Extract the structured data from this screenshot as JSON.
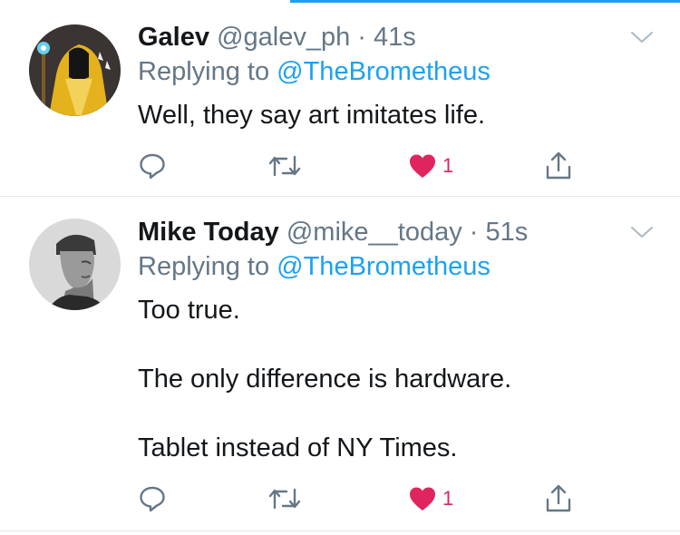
{
  "tweets": [
    {
      "name": "Galev",
      "handle": "@galev_ph",
      "time": "· 41s",
      "replying_prefix": "Replying to ",
      "replying_to": "@TheBrometheus",
      "text": [
        "Well, they say art imitates life."
      ],
      "like_count": "1",
      "liked": true
    },
    {
      "name": "Mike Today",
      "handle": "@mike__today",
      "time": "· 51s",
      "replying_prefix": "Replying to ",
      "replying_to": "@TheBrometheus",
      "text": [
        "Too true.",
        "The only difference is hardware.",
        "Tablet instead of NY Times."
      ],
      "like_count": "1",
      "liked": true
    }
  ],
  "icons": {
    "reply": "reply-icon",
    "retweet": "retweet-icon",
    "like": "heart-icon",
    "share": "share-icon",
    "menu": "chevron-down-icon"
  },
  "colors": {
    "accent": "#1da1f2",
    "like": "#e0245e",
    "text": "#14171a",
    "secondary": "#657786",
    "divider": "#e1e8ed"
  }
}
